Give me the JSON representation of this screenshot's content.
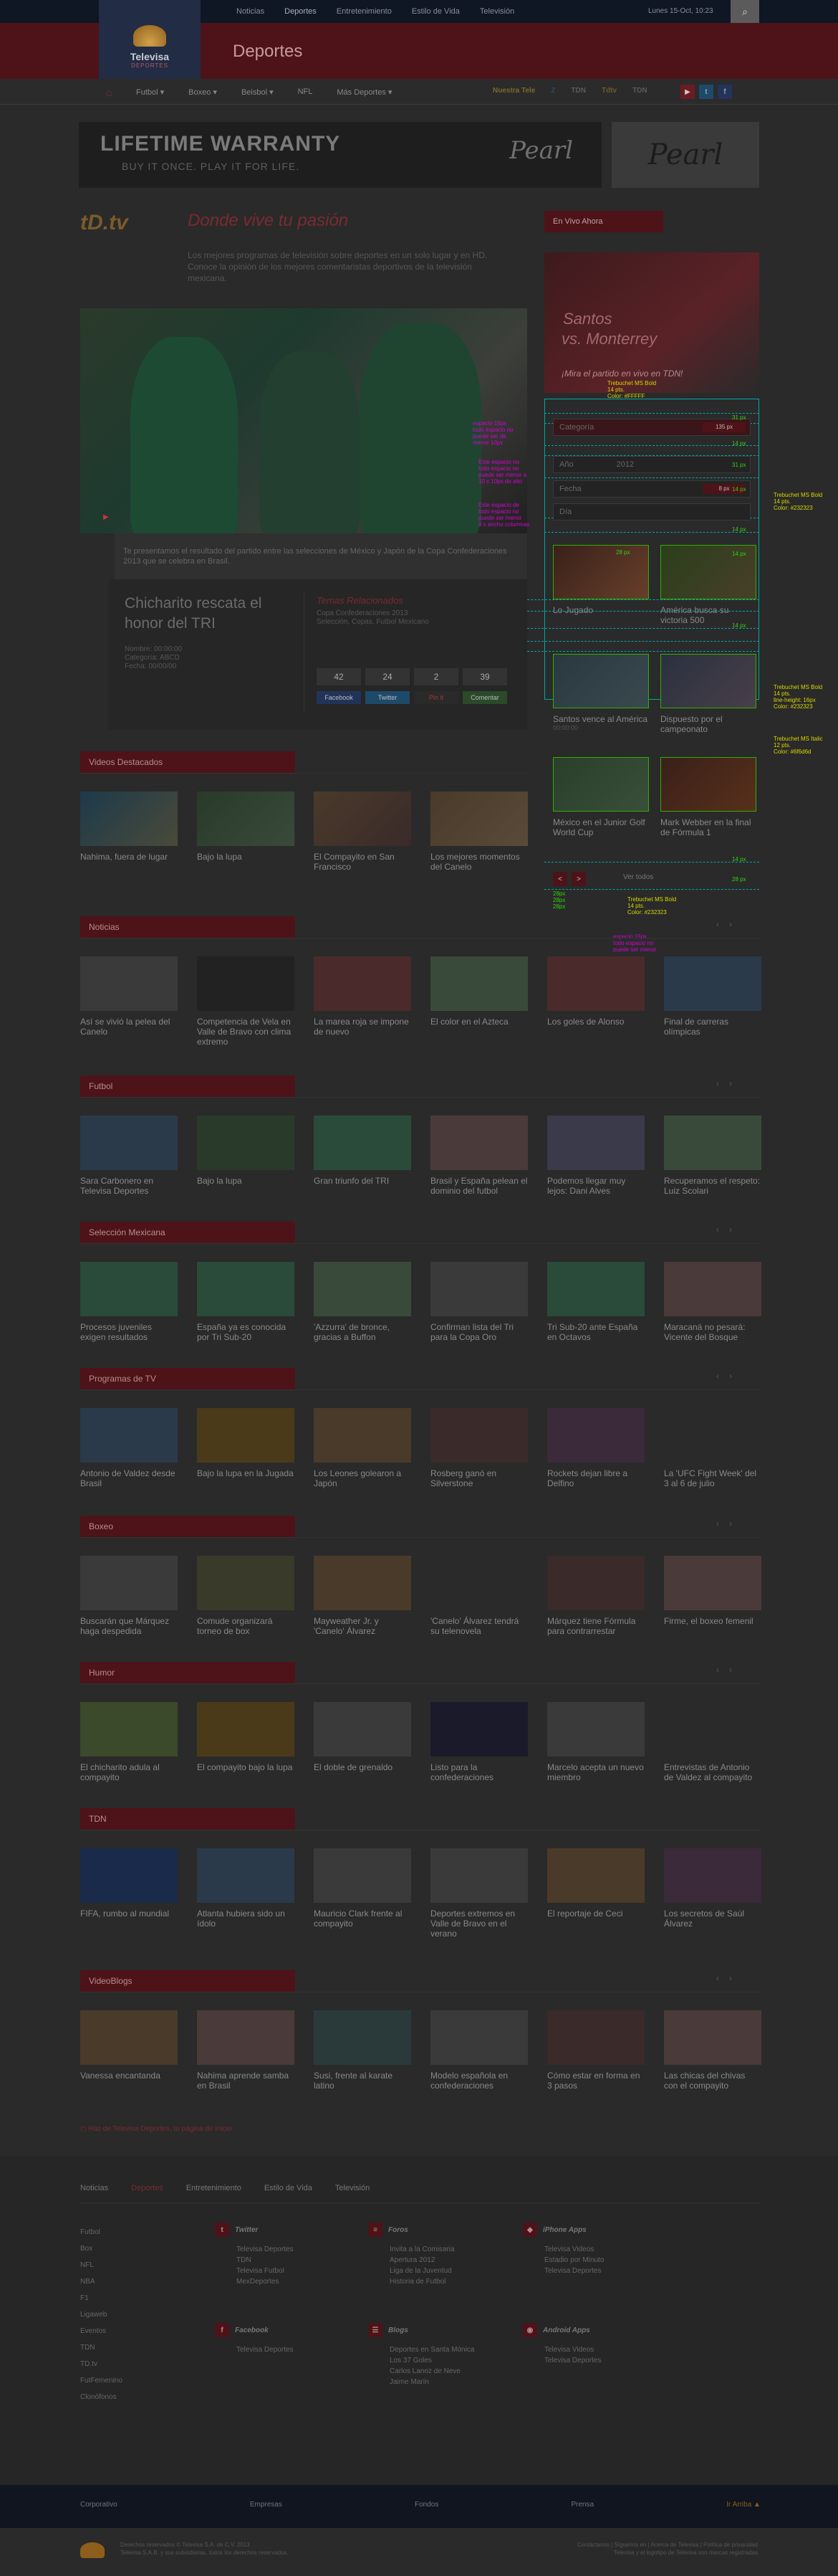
{
  "topbar": {
    "nav": [
      "Noticias",
      "Deportes",
      "Entretenimiento",
      "Estilo de Vida",
      "Televisión"
    ],
    "date": "Lunes 15-Oct, 10:23"
  },
  "logo": {
    "line1": "Televisa",
    "line2": "DEPORTES"
  },
  "section_title": "Deportes",
  "mainnav": {
    "items": [
      "Futbol",
      "Boxeo",
      "Beisbol",
      "NFL",
      "Más Deportes"
    ],
    "partner_logos": [
      "Nuestra Tele",
      "Z",
      "TDN",
      "Tdtv",
      "TDN"
    ],
    "social": [
      "yt-icon",
      "tw-icon",
      "fb-icon"
    ]
  },
  "banner": {
    "headline": "LIFETIME WARRANTY",
    "tagline": "BUY IT ONCE.  PLAY IT FOR LIFE.",
    "brand": "Pearl",
    "brand2": "Pearl"
  },
  "brand_block": {
    "logo": "tD.tv",
    "slogan": "Donde vive tu pasión",
    "intro": "Los mejores programas de televisión sobre deportes en un solo lugar y en HD. Conoce la opinión de los mejores comentaristas deportivos de la televisión mexicana."
  },
  "hero": {
    "caption": "Te presentamos el resultado del partido entre las selecciones de México y Japón de la Copa Confederaciones 2013 que se celebra en Brasil."
  },
  "article": {
    "title": "Chicharito rescata el honor del TRI",
    "meta": [
      "Nombre: 00:00:00",
      "Categoría: ABCD",
      "Fecha: 00/00/00"
    ],
    "related_title": "Temas Relacionados",
    "related": [
      "Copa Confederaciones 2013",
      "Selección, Copas, Futbol Mexicano"
    ],
    "counts": [
      "42",
      "24",
      "2",
      "39"
    ],
    "share": [
      "Facebook",
      "Twitter",
      "Pin it",
      "Comentar"
    ]
  },
  "sidebar": {
    "live_tab": "En Vivo Ahora",
    "live_img": {
      "t1": "Santos",
      "t2": "vs. Monterrey",
      "t3": "¡Mira el partido en vivo en TDN!"
    },
    "filters": [
      {
        "label": "Categoría",
        "btn": ""
      },
      {
        "label": "Año",
        "value": "2012"
      },
      {
        "label": "Fecha",
        "btn": ""
      },
      {
        "label": "Día",
        "btn": ""
      }
    ],
    "grid": [
      {
        "label": "Lo Jugado",
        "sub": ""
      },
      {
        "label": "América busca su victoria 500",
        "sub": ""
      },
      {
        "label": "Santos vence al América",
        "sub": "00:00:00"
      },
      {
        "label": "Dispuesto por el campeonato",
        "sub": ""
      },
      {
        "label": "México en el Junior Golf World Cup",
        "sub": ""
      },
      {
        "label": "Mark Webber en la final de Fórmula 1",
        "sub": ""
      }
    ],
    "pager": [
      "<",
      ">"
    ],
    "pager_more": "Ver todos"
  },
  "annotations": {
    "title_spec": "Trebuchet MS Bold\n14 pts.\nColor: #FFFFF",
    "spec2": "Trebuchet MS Bold\n14 pts.\nColor: #232323",
    "spec3": "Trebuchet MS Bold\n14 pts.\nline-height: 16px\nColor: #232323",
    "spec4": "Trebuchet MS Italic\n12 pts.\nColor: #6f6d6d",
    "spec5": "Trebuchet MS Bold\n14 pts.\nColor: #232323",
    "m1": "espacio 15px\ntodo espacio no\npuede ser de\nmenor 10px",
    "m2": "Este espacio no\ntodo espacio no\npuede ser menor a\n10 x 10px de alto",
    "m3": "Este espacio de\ntodo espacio no\npuede ser menor\n4 x ancho columnas",
    "m4": "espacio 15px\ntodo espacio no\npuede ser menor",
    "g_labels": [
      "31 px",
      "14 px",
      "31 px",
      "14 px",
      "14 px",
      "14 px",
      "14 px",
      "28 px",
      "135 px",
      "28 px",
      "14 px",
      "14 px",
      "14 px",
      "28 px",
      "8 px",
      "8 px",
      "8 px",
      "28 px"
    ],
    "g_small": "28px\n28px\n28px"
  },
  "sections": [
    {
      "title": "Videos Destacados",
      "items": [
        "Nahima, fuera de lugar",
        "Bajo la lupa",
        "El Compayito en San Francisco",
        "Los mejores momentos del Canelo"
      ]
    },
    {
      "title": "Noticias",
      "items": [
        "Así se vivió la pelea del Canelo",
        "Competencia de Vela en Valle de Bravo con clima extremo",
        "La marea roja se impone de nuevo",
        "El color en el Azteca",
        "Los goles de Alonso",
        "Final de carreras olímpicas"
      ]
    },
    {
      "title": "Futbol",
      "items": [
        "Sara Carbonero en Televisa Deportes",
        "Bajo la lupa",
        "Gran triunfo del TRI",
        "Brasil y España pelean el dominio del futbol",
        "Podemos llegar muy lejos: Dani Alves",
        "Recuperamos el respeto: Luiz Scolari"
      ]
    },
    {
      "title": "Selección Mexicana",
      "items": [
        "Procesos juveniles exigen resultados",
        "España ya es conocida por Tri Sub-20",
        "'Azzurra' de bronce, gracias a Buffon",
        "Confirman lista del Tri para la Copa Oro",
        "Tri Sub-20 ante España en Octavos",
        "Maracaná no pesará: Vicente del Bosque"
      ]
    },
    {
      "title": "Programas de TV",
      "items": [
        "Antonio de Valdez desde Brasil",
        "Bajo la lupa en la Jugada",
        "Los Leones golearon a Japón",
        "Rosberg ganó en Silverstone",
        "Rockets dejan libre a Delfino",
        "La 'UFC Fight Week' del 3 al 6 de julio"
      ]
    },
    {
      "title": "Boxeo",
      "items": [
        "Buscarán que Márquez haga despedida",
        "Comude organizará torneo de box",
        "Mayweather Jr. y 'Canelo' Álvarez",
        "'Canelo' Álvarez tendrá su telenovela",
        "Márquez tiene Fórmula para contrarrestar",
        "Firme, el boxeo femenil"
      ]
    },
    {
      "title": "Humor",
      "items": [
        "El chicharito adula al compayito",
        "El compayito bajo la lupa",
        "El doble de grenaldo",
        "Listo para la confederaciones",
        "Marcelo acepta un nuevo miembro",
        "Entrevistas de Antonio de Valdez al compayito"
      ]
    },
    {
      "title": "TDN",
      "items": [
        "FIFA, rumbo al mundial",
        "Atlanta hubiera sido un ídolo",
        "Mauricio Clark frente al compayito",
        "Deportes extremos en Valle de Bravo en el verano",
        "El reportaje de Ceci",
        "Los secretos de Saúl Álvarez"
      ]
    },
    {
      "title": "VideoBlogs",
      "items": [
        "Vanessa encantanda",
        "Nahima aprende samba en Brasil",
        "Susi, frente al karate latino",
        "Modelo española en confederaciones",
        "Cómo estar en forma en 3 pasos",
        "Las chicas del chivas con el compayito"
      ]
    }
  ],
  "footer_note": "Haz de Televisa Deportes, tu página de Inicio",
  "footer": {
    "nav": [
      "Noticias",
      "Deportes",
      "Entretenimiento",
      "Estilo de Vida",
      "Televisión"
    ],
    "left": [
      "Futbol",
      "Box",
      "NFL",
      "NBA",
      "F1",
      "Ligaweb",
      "Eventos",
      "TDN",
      "TD.tv",
      "FutFemenino",
      "Clonófonos"
    ],
    "cols": [
      {
        "title": "Twitter",
        "items": [
          "Televisa Deportes",
          "TDN",
          "Televisa Futbol",
          "MexDeportes"
        ]
      },
      {
        "title": "Foros",
        "items": [
          "Invita a la Comisaria",
          "Apertura 2012",
          "Liga de la Juventud",
          "Historia de Futbol"
        ]
      },
      {
        "title": "iPhone Apps",
        "items": [
          "Televisa Videos",
          "Estadio por Minuto",
          "Televisa Deportes"
        ]
      },
      {
        "title": "Facebook",
        "items": [
          "Televisa Deportes"
        ]
      },
      {
        "title": "Blogs",
        "items": [
          "Deportes en Santa Mónica",
          "Los 37 Goles",
          "Carlos Lanoz de Neve",
          "Jaime Marín"
        ]
      },
      {
        "title": "Android Apps",
        "items": [
          "Televisa Videos",
          "Televisa Deportes"
        ]
      }
    ]
  },
  "footbar": [
    "Corporativo",
    "Empresas",
    "Fondos",
    "Prensa",
    "Ir Arriba ▲"
  ],
  "bottom": {
    "legal": "Derechos reservados © Televisa S.A. de C.V. 2013\nTelevisa S.A.B. y sus subsidiarias, todos los derechos reservados.",
    "links": "Contáctanos | Síguenos en | Acerca de Televisa | Política de privacidad\nTelevisa y el logotipo de Televisa son marcas registradas"
  },
  "colors": {
    "red": "#4d1318",
    "navy": "#0f1624",
    "gold": "#8e5e1c"
  }
}
